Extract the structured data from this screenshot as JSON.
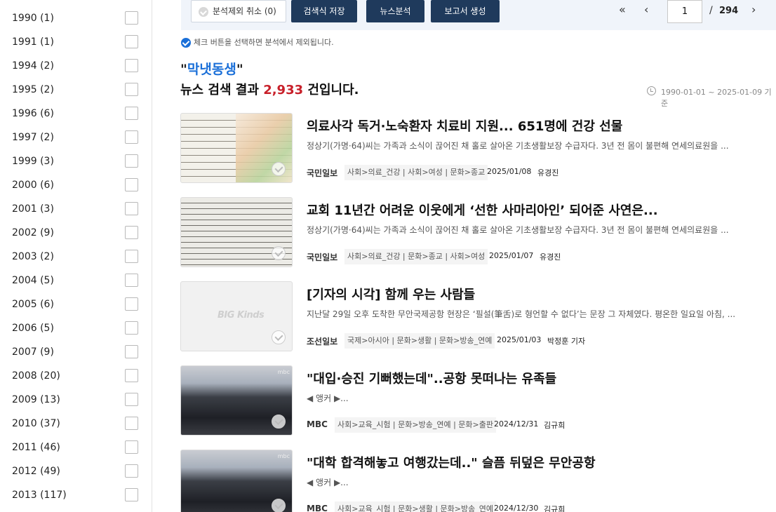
{
  "sidebar": {
    "years": [
      {
        "label": "1990 (1)"
      },
      {
        "label": "1991 (1)"
      },
      {
        "label": "1994 (2)"
      },
      {
        "label": "1995 (2)"
      },
      {
        "label": "1996 (6)"
      },
      {
        "label": "1997 (2)"
      },
      {
        "label": "1999 (3)"
      },
      {
        "label": "2000 (6)"
      },
      {
        "label": "2001 (3)"
      },
      {
        "label": "2002 (9)"
      },
      {
        "label": "2003 (2)"
      },
      {
        "label": "2004 (5)"
      },
      {
        "label": "2005 (6)"
      },
      {
        "label": "2006 (5)"
      },
      {
        "label": "2007 (9)"
      },
      {
        "label": "2008 (20)"
      },
      {
        "label": "2009 (13)"
      },
      {
        "label": "2010 (37)"
      },
      {
        "label": "2011 (46)"
      },
      {
        "label": "2012 (49)"
      },
      {
        "label": "2013 (117)"
      }
    ]
  },
  "toolbar": {
    "exclude_label": "분석제외 취소 (0)",
    "save_query_label": "검색식 저장",
    "news_analysis_label": "뉴스분석",
    "report_label": "보고서 생성"
  },
  "pager": {
    "first_icon": "double-chevron-left",
    "prev_icon": "chevron-left",
    "next_icon": "chevron-right",
    "current_page": "1",
    "separator": "/",
    "total_pages": "294"
  },
  "info": {
    "text": "체크 버튼을 선택하면 분석에서 제외됩니다."
  },
  "query": {
    "open_quote": "\"",
    "keyword": "막냇동생",
    "close_quote": "\""
  },
  "result": {
    "prefix": "뉴스 검색 결과",
    "count": "2,933",
    "suffix": "건입니다.",
    "date_range": "1990-01-01 ~ 2025-01-09 기준"
  },
  "articles": [
    {
      "title": "의료사각 독거·노숙환자 치료비 지원... 651명에 건강 선물",
      "summary": "정상기(가명·64)씨는 가족과 소식이 끊어진 채 홀로 살아온 기초생활보장 수급자다. 3년 전 몸이 불편해 연세의료원을 ...",
      "press": "국민일보",
      "categories": "사회>의료_건강 | 사회>여성 | 문화>종교",
      "date": "2025/01/08",
      "reporter": "유경진",
      "thumb": "letter"
    },
    {
      "title": "교회 11년간 어려운 이웃에게 ‘선한 사마리아인’ 되어준 사연은...",
      "summary": "정상기(가명·64)씨는 가족과 소식이 끊어진 채 홀로 살아온 기초생활보장 수급자다. 3년 전 몸이 불편해 연세의료원을 ...",
      "press": "국민일보",
      "categories": "사회>의료_건강 | 문화>종교 | 사회>여성",
      "date": "2025/01/07",
      "reporter": "유경진",
      "thumb": "handwriting"
    },
    {
      "title": "[기자의 시각] 함께 우는 사람들",
      "summary": "지난달 29일 오후 도착한 무안국제공항 현장은 ‘필설(筆舌)로 형언할 수 없다’는 문장 그 자체였다. 평온한 일요일 아침, ...",
      "press": "조선일보",
      "categories": "국제>아시아 | 문화>생활 | 문화>방송_연예",
      "date": "2025/01/03",
      "reporter": "박정훈 기자",
      "thumb": "blank",
      "logo": "BIG Kinds"
    },
    {
      "title": "\"대입·승진 기뻐했는데\"..공항 못떠나는 유족들",
      "summary": "◀ 앵커 ▶...",
      "press": "MBC",
      "categories": "사회>교육_시험 | 문화>방송_연예 | 문화>출판",
      "date": "2024/12/31",
      "reporter": "김규희",
      "thumb": "crowd",
      "tag": "mbc"
    },
    {
      "title": "\"대학 합격해놓고 여행갔는데..\" 슬픔 뒤덮은 무안공항",
      "summary": "◀ 앵커 ▶...",
      "press": "MBC",
      "categories": "사회>교육_시험 | 문화>생활 | 문화>방송_연예",
      "date": "2024/12/30",
      "reporter": "김규희",
      "thumb": "crowd",
      "tag": "mbc"
    }
  ]
}
